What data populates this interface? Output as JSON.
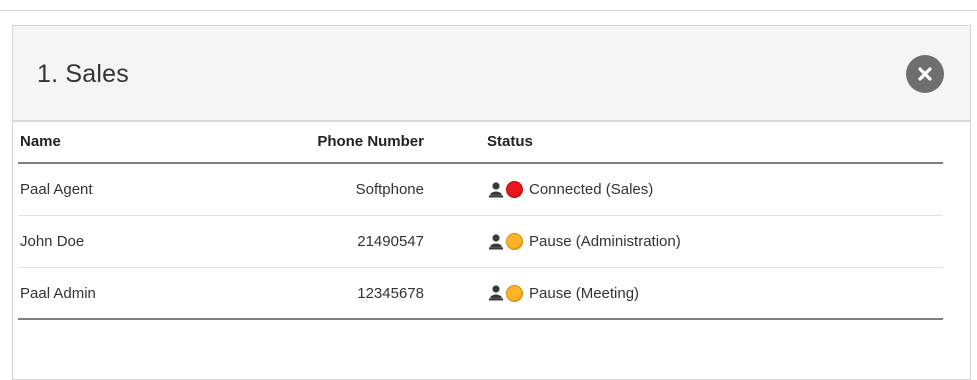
{
  "queue_panel": {
    "title": "1. Sales",
    "close_icon": "close-icon"
  },
  "table": {
    "columns": {
      "name": "Name",
      "phone": "Phone Number",
      "status": "Status"
    },
    "rows": [
      {
        "name": "Paal Agent",
        "phone": "Softphone",
        "status": "Connected (Sales)",
        "status_color": "#e8171b",
        "status_border": "#b40d10"
      },
      {
        "name": "John Doe",
        "phone": "21490547",
        "status": "Pause (Administration)",
        "status_color": "#fbb427",
        "status_border": "#d38c0c"
      },
      {
        "name": "Paal Admin",
        "phone": "12345678",
        "status": "Pause (Meeting)",
        "status_color": "#fbb427",
        "status_border": "#d38c0c"
      }
    ]
  },
  "colors": {
    "header_bg": "#f5f5f5",
    "close_button": "#6f6f6f",
    "rule_dark": "#7f7f7f",
    "rule_light": "#e2e2e2"
  }
}
